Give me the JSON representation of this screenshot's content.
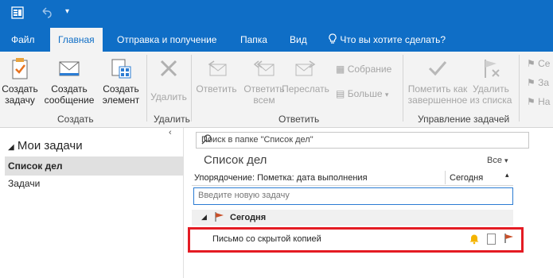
{
  "tabs": [
    "Файл",
    "Главная",
    "Отправка и получение",
    "Папка",
    "Вид"
  ],
  "tell_me": "Что вы хотите сделать?",
  "ribbon": {
    "create_task": "Создать задачу",
    "create_message": "Создать сообщение",
    "create_item": "Создать элемент",
    "group_create": "Создать",
    "delete": "Удалить",
    "group_delete": "Удалить",
    "reply": "Ответить",
    "reply_all": "Ответить всем",
    "forward": "Переслать",
    "meeting": "Собрание",
    "more": "Больше",
    "group_respond": "Ответить",
    "mark_complete": "Пометить как завершенное",
    "remove_from_list": "Удалить из списка",
    "group_manage": "Управление задачей",
    "right_trunc": [
      "Се",
      "За",
      "На"
    ]
  },
  "nav": {
    "header": "Мои задачи",
    "items": [
      "Список дел",
      "Задачи"
    ]
  },
  "main": {
    "search_placeholder": "Поиск в папке \"Список дел\"",
    "title": "Список дел",
    "filter": "Все",
    "sort_label": "Упорядочение: Пометка: дата выполнения",
    "sort_col": "Сегодня",
    "new_task_placeholder": "Введите новую задачу",
    "group": "Сегодня",
    "task": "Письмо со скрытой копией"
  },
  "colors": {
    "accent": "#0f6ec6",
    "highlight": "#e41b23",
    "flag": "#c8502a",
    "bell": "#f4b400"
  }
}
